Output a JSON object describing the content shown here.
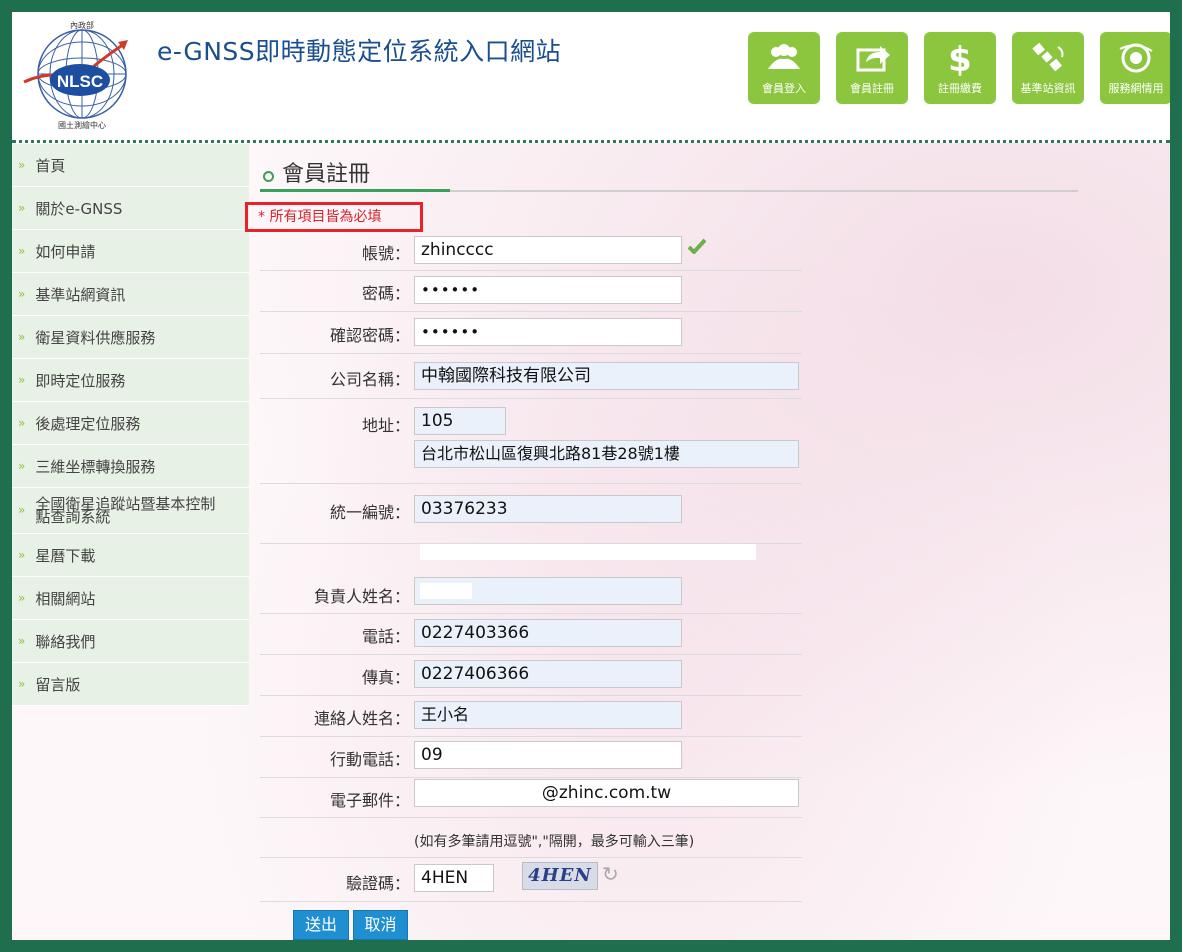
{
  "header": {
    "site_title": "e-GNSS即時動態定位系統入口網站",
    "logo": {
      "top": "內政部",
      "center": "NLSC",
      "bottom": "國土測繪中心"
    },
    "nav_buttons": [
      {
        "label": "會員登入",
        "icon": "members-icon"
      },
      {
        "label": "會員註冊",
        "icon": "share-icon"
      },
      {
        "label": "註冊繳費",
        "icon": "dollar-icon"
      },
      {
        "label": "基準站資訊",
        "icon": "satellite-icon"
      },
      {
        "label": "服務網情用",
        "icon": "network-icon"
      }
    ]
  },
  "sidebar": {
    "items": [
      {
        "label": "首頁"
      },
      {
        "label": "關於e-GNSS"
      },
      {
        "label": "如何申請"
      },
      {
        "label": "基準站網資訊"
      },
      {
        "label": "衛星資料供應服務"
      },
      {
        "label": "即時定位服務"
      },
      {
        "label": "後處理定位服務"
      },
      {
        "label": "三維坐標轉換服務"
      },
      {
        "label": "全國衛星追蹤站暨基本控制點查詢系統"
      },
      {
        "label": "星曆下載"
      },
      {
        "label": "相關網站"
      },
      {
        "label": "聯絡我們"
      },
      {
        "label": "留言版"
      }
    ]
  },
  "main": {
    "page_title": "會員註冊",
    "required_note": "* 所有項目皆為必填"
  },
  "form": {
    "colon": "：",
    "account": {
      "label": "帳號",
      "value": "zhincccc"
    },
    "password": {
      "label": "密碼",
      "value": "••••••"
    },
    "confirm_password": {
      "label": "確認密碼",
      "value": "••••••"
    },
    "company": {
      "label": "公司名稱",
      "value": "中翰國際科技有限公司"
    },
    "address": {
      "label": "地址",
      "zip": "105",
      "value": "台北市松山區復興北路81巷28號1樓"
    },
    "tax_id": {
      "label": "統一編號",
      "value": "03376233"
    },
    "owner": {
      "label": "負責人姓名",
      "value": ""
    },
    "phone": {
      "label": "電話",
      "value": "0227403366"
    },
    "fax": {
      "label": "傳真",
      "value": "0227406366"
    },
    "contact": {
      "label": "連絡人姓名",
      "value": "王小名"
    },
    "mobile": {
      "label": "行動電話",
      "value": "09"
    },
    "email": {
      "label": "電子郵件",
      "value": "@zhinc.com.tw",
      "note": "(如有多筆請用逗號\",\"隔開，最多可輸入三筆)"
    },
    "captcha": {
      "label": "驗證碼",
      "value": "4HEN",
      "image_text": "4HEN"
    },
    "submit_label": "送出",
    "cancel_label": "取消"
  }
}
